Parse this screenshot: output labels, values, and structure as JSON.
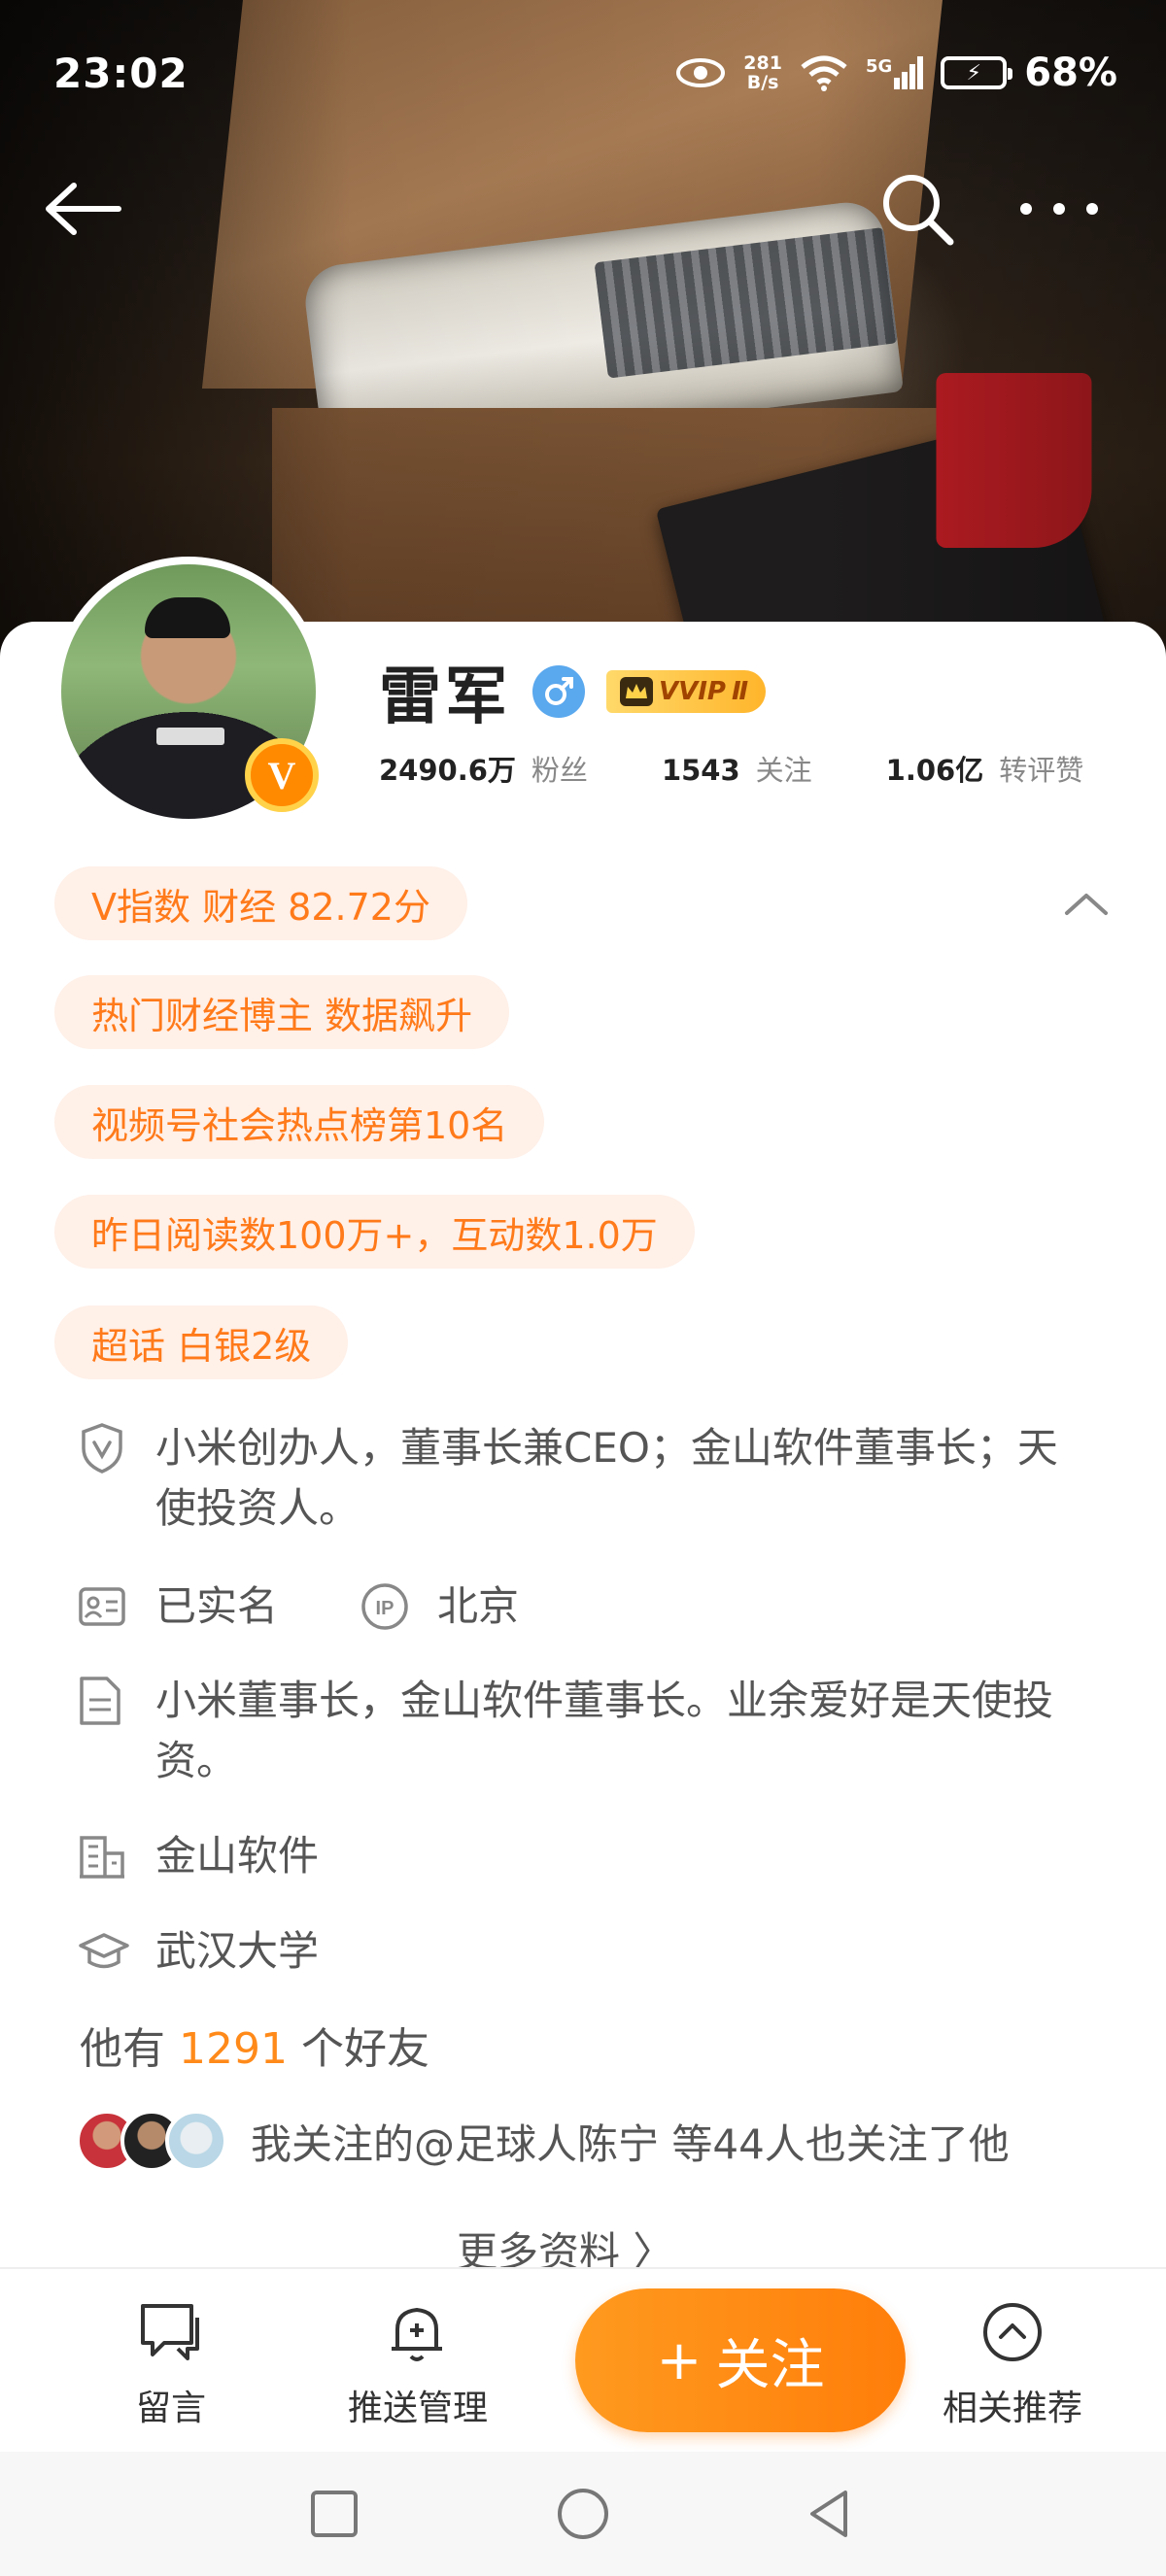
{
  "status_bar": {
    "time": "23:02",
    "net_speed_value": "281",
    "net_speed_unit": "B/s",
    "network": "5G",
    "battery": "68%"
  },
  "profile": {
    "name": "雷军",
    "vvip_label": "VVIP",
    "vvip_level": "Ⅱ",
    "verified_badge": "V",
    "stats": [
      {
        "value": "2490.6万",
        "label": "粉丝"
      },
      {
        "value": "1543",
        "label": "关注"
      },
      {
        "value": "1.06亿",
        "label": "转评赞"
      }
    ]
  },
  "tags": [
    "V指数 财经 82.72分",
    "热门财经博主 数据飙升",
    "视频号社会热点榜第10名",
    "昨日阅读数100万+，互动数1.0万",
    "超话 白银2级"
  ],
  "info": {
    "verification": "小米创办人，董事长兼CEO；金山软件董事长；天使投资人。",
    "real_name": "已实名",
    "ip_location": "北京",
    "bio": "小米董事长，金山软件董事长。业余爱好是天使投资。",
    "company": "金山软件",
    "school": "武汉大学",
    "friends_prefix": "他有",
    "friends_count": "1291",
    "friends_suffix": "个好友",
    "mutual_follow": "我关注的@足球人陈宁 等44人也关注了他",
    "more_info": "更多资料 〉"
  },
  "actions": {
    "message": "留言",
    "push_manage": "推送管理",
    "follow_plus": "+",
    "follow": "关注",
    "related": "相关推荐"
  },
  "colors": {
    "accent": "#ff7a1a",
    "tag_bg": "#fff0e8",
    "follow_button": "#ff8a14",
    "gender_blue": "#5aa8ee"
  }
}
